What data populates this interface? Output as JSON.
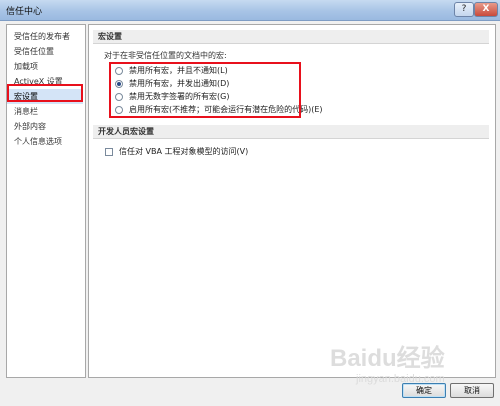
{
  "window": {
    "title": "信任中心",
    "help_glyph": "?",
    "close_glyph": "X"
  },
  "sidebar": {
    "items": [
      {
        "label": "受信任的发布者"
      },
      {
        "label": "受信任位置"
      },
      {
        "label": "加载项"
      },
      {
        "label": "ActiveX 设置"
      },
      {
        "label": "宏设置",
        "selected": true
      },
      {
        "label": "消息栏"
      },
      {
        "label": "外部内容"
      },
      {
        "label": "个人信息选项"
      }
    ]
  },
  "macro_settings": {
    "header": "宏设置",
    "prompt": "对于在非受信任位置的文档中的宏:",
    "options": [
      {
        "label": "禁用所有宏，并且不通知(L)",
        "checked": false
      },
      {
        "label": "禁用所有宏，并发出通知(D)",
        "checked": true
      },
      {
        "label": "禁用无数字签署的所有宏(G)",
        "checked": false
      },
      {
        "label": "启用所有宏(不推荐；可能会运行有潜在危险的代码)(E)",
        "checked": false
      }
    ]
  },
  "developer_settings": {
    "header": "开发人员宏设置",
    "trust_vba_label": "信任对 VBA 工程对象模型的访问(V)",
    "trust_vba_checked": false
  },
  "buttons": {
    "ok": "确定",
    "cancel": "取消"
  },
  "watermark": {
    "brand": "Baidu经验",
    "url": "jingyan.baidu.com"
  },
  "colors": {
    "highlight_box": "#e8101c",
    "selected_item": "#d4e4f7",
    "titlebar": "#a8c4e6"
  }
}
